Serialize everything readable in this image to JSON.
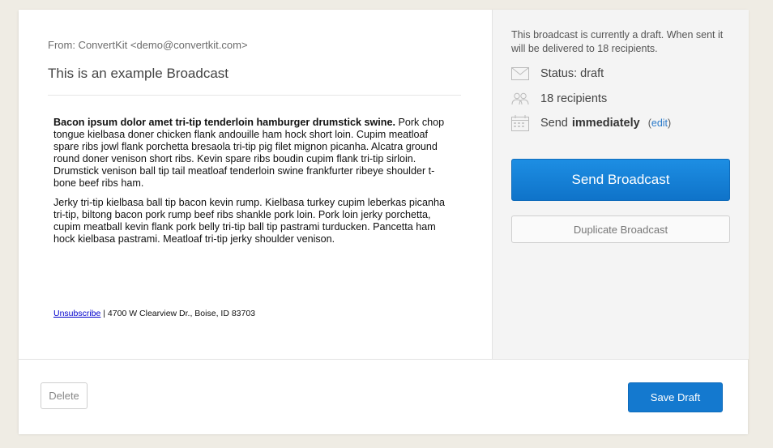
{
  "email": {
    "from": "From: ConvertKit <demo@convertkit.com>",
    "subject": "This is an example Broadcast",
    "paragraph1_bold": "Bacon ipsum dolor amet tri-tip tenderloin hamburger drumstick swine.",
    "paragraph1_rest": " Pork chop tongue kielbasa doner chicken flank andouille ham hock short loin. Cupim meatloaf spare ribs jowl flank porchetta bresaola tri-tip pig filet mignon picanha. Alcatra ground round doner venison short ribs. Kevin spare ribs boudin cupim flank tri-tip sirloin. Drumstick venison ball tip tail meatloaf tenderloin swine frankfurter ribeye shoulder t-bone beef ribs ham.",
    "paragraph2": "Jerky tri-tip kielbasa ball tip bacon kevin rump. Kielbasa turkey cupim leberkas picanha tri-tip, biltong bacon pork rump beef ribs shankle pork loin. Pork loin jerky porchetta, cupim meatball kevin flank pork belly tri-tip ball tip pastrami turducken. Pancetta ham hock kielbasa pastrami. Meatloaf tri-tip jerky shoulder venison.",
    "unsubscribe_label": "Unsubscribe",
    "address": " | 4700 W Clearview Dr., Boise, ID 83703"
  },
  "sidebar": {
    "note": "This broadcast is currently a draft. When sent it will be delivered to 18 recipients.",
    "status": "Status: draft",
    "recipients": "18 recipients",
    "send_prefix": "Send",
    "send_timing": "immediately",
    "edit_open": "(",
    "edit_label": "edit",
    "edit_close": ")",
    "send_button": "Send Broadcast",
    "duplicate_button": "Duplicate Broadcast",
    "icons": [
      "envelope-icon",
      "people-icon",
      "calendar-icon"
    ]
  },
  "footer": {
    "delete_button": "Delete",
    "save_button": "Save Draft"
  },
  "colors": {
    "page_bg": "#efece4",
    "primary": "#1479cf",
    "link": "#2b7ac9"
  }
}
